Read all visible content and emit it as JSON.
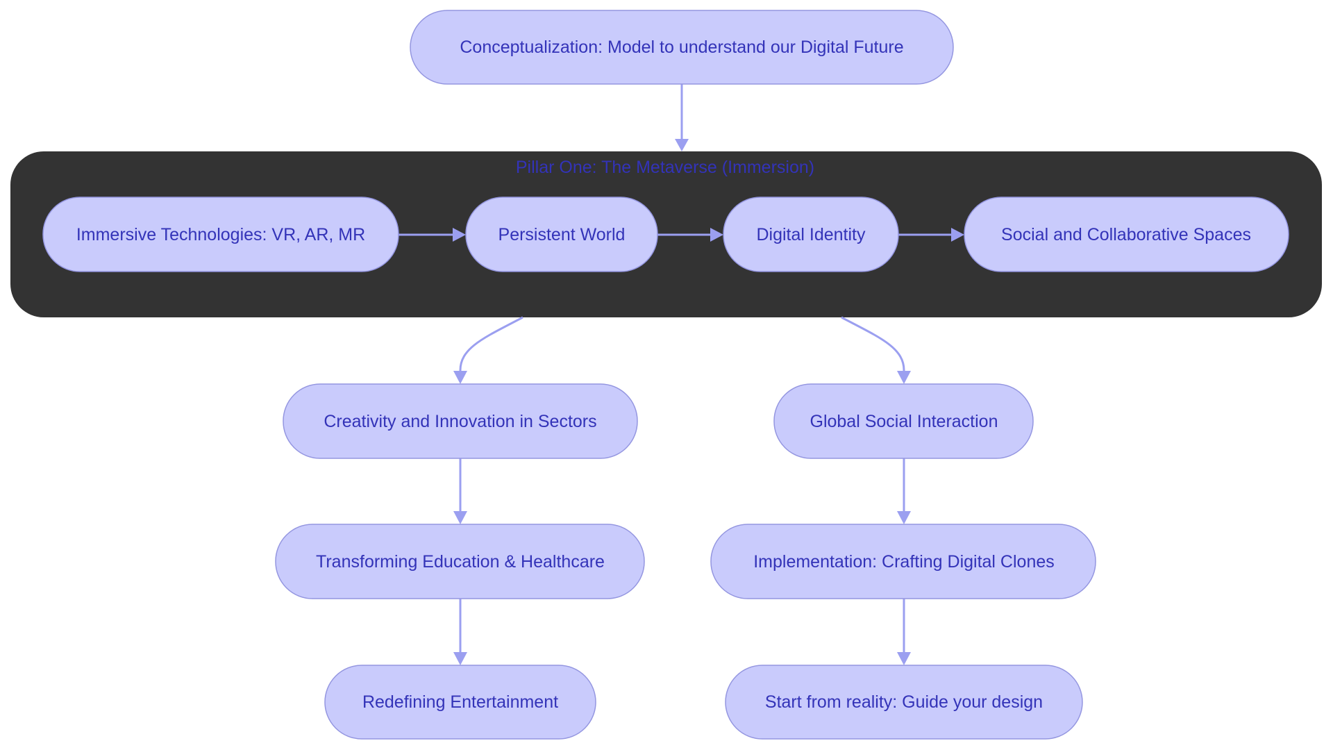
{
  "diagram": {
    "type": "flowchart",
    "colors": {
      "node_fill": "#c9cbfc",
      "node_stroke": "#9496e0",
      "node_text": "#3333b8",
      "edge": "#9b9ff0",
      "subgraph_fill": "#333333",
      "background": "#ffffff"
    },
    "subgraph": {
      "title": "Pillar One: The Metaverse (Immersion)"
    },
    "nodes": {
      "conceptualization": "Conceptualization: Model to understand our Digital Future",
      "immersive_tech": "Immersive Technologies: VR, AR, MR",
      "persistent_world": "Persistent World",
      "digital_identity": "Digital Identity",
      "social_spaces": "Social and Collaborative Spaces",
      "creativity": "Creativity and Innovation in Sectors",
      "global_social": "Global Social Interaction",
      "transforming": "Transforming Education & Healthcare",
      "implementation": "Implementation: Crafting Digital Clones",
      "redefining": "Redefining Entertainment",
      "start_reality": "Start from reality: Guide your design"
    },
    "edges": [
      {
        "from": "conceptualization",
        "to": "subgraph"
      },
      {
        "from": "immersive_tech",
        "to": "persistent_world"
      },
      {
        "from": "persistent_world",
        "to": "digital_identity"
      },
      {
        "from": "digital_identity",
        "to": "social_spaces"
      },
      {
        "from": "subgraph",
        "to": "creativity"
      },
      {
        "from": "subgraph",
        "to": "global_social"
      },
      {
        "from": "creativity",
        "to": "transforming"
      },
      {
        "from": "transforming",
        "to": "redefining"
      },
      {
        "from": "global_social",
        "to": "implementation"
      },
      {
        "from": "implementation",
        "to": "start_reality"
      }
    ]
  }
}
